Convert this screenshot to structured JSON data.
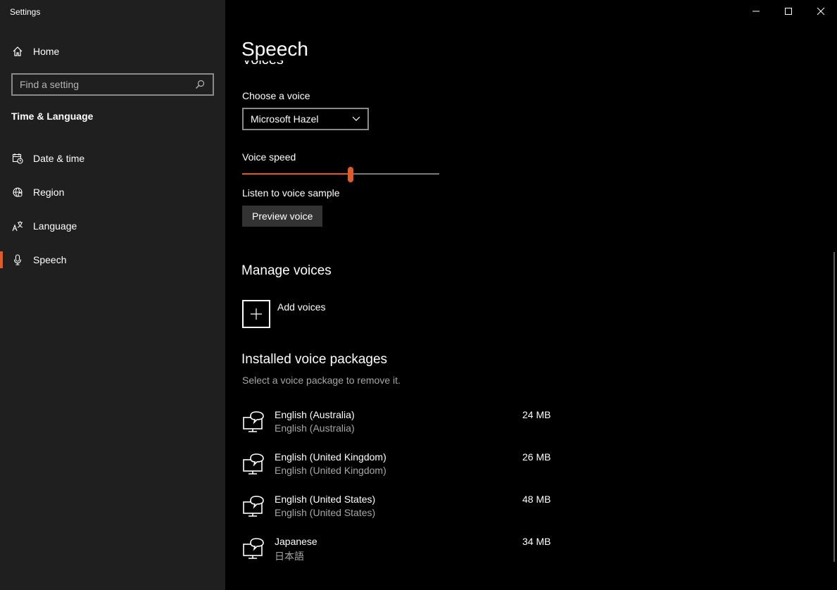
{
  "window": {
    "app_title": "Settings"
  },
  "sidebar": {
    "home_label": "Home",
    "search_placeholder": "Find a setting",
    "section_title": "Time & Language",
    "items": [
      {
        "label": "Date & time",
        "icon": "calendar-clock-icon"
      },
      {
        "label": "Region",
        "icon": "globe-icon"
      },
      {
        "label": "Language",
        "icon": "language-icon"
      },
      {
        "label": "Speech",
        "icon": "microphone-icon",
        "active": true
      }
    ]
  },
  "main": {
    "page_title": "Speech",
    "voices_heading": "Voices",
    "choose_voice_label": "Choose a voice",
    "selected_voice": "Microsoft Hazel",
    "voice_speed_label": "Voice speed",
    "voice_speed_fraction": 0.55,
    "listen_label": "Listen to voice sample",
    "preview_button": "Preview voice",
    "manage_heading": "Manage voices",
    "add_voices_label": "Add voices",
    "installed_heading": "Installed voice packages",
    "installed_hint": "Select a voice package to remove it.",
    "packages": [
      {
        "name": "English (Australia)",
        "native": "English (Australia)",
        "size": "24 MB"
      },
      {
        "name": "English (United Kingdom)",
        "native": "English (United Kingdom)",
        "size": "26 MB"
      },
      {
        "name": "English (United States)",
        "native": "English (United States)",
        "size": "48 MB"
      },
      {
        "name": "Japanese",
        "native": "日本語",
        "size": "34 MB"
      }
    ]
  },
  "colors": {
    "accent": "#e05a2b",
    "sidebar_bg": "#1f1f1f",
    "content_bg": "#000000"
  }
}
